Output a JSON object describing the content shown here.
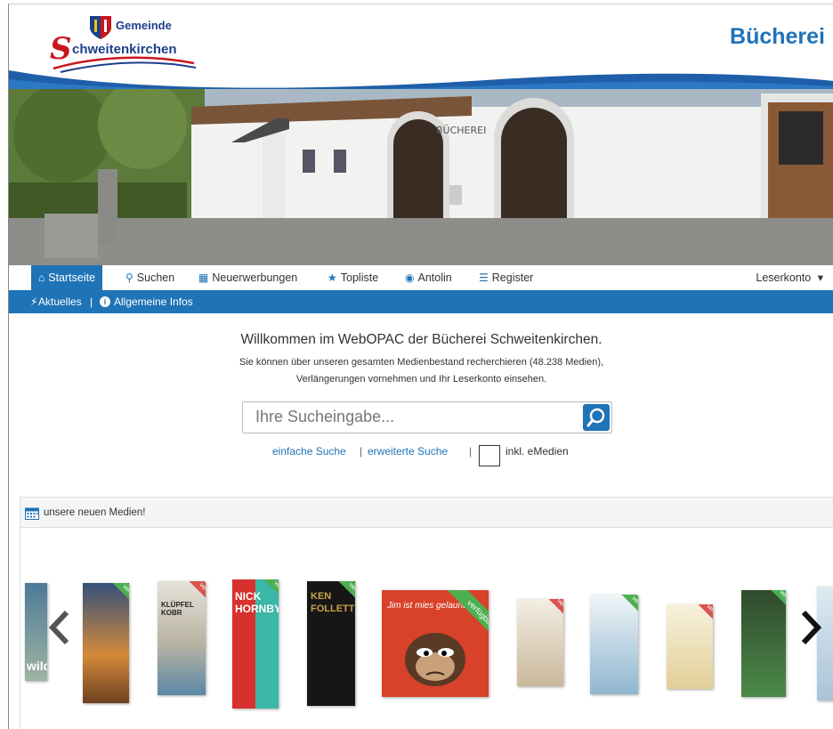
{
  "header": {
    "logo_line1": "Gemeinde",
    "logo_letter": "S",
    "logo_line2": "chweitenkirchen",
    "brand": "Bücherei",
    "hero_sign": "BÜCHEREI"
  },
  "nav": {
    "items": [
      {
        "label": "Startseite",
        "icon": "home-icon"
      },
      {
        "label": "Suchen",
        "icon": "search-icon"
      },
      {
        "label": "Neuerwerbungen",
        "icon": "calendar-icon"
      },
      {
        "label": "Topliste",
        "icon": "star-icon"
      },
      {
        "label": "Antolin",
        "icon": "globe-icon"
      },
      {
        "label": "Register",
        "icon": "list-icon"
      }
    ],
    "account_label": "Leserkonto",
    "account_caret": "▾"
  },
  "subnav": {
    "aktuelles": "Aktuelles",
    "separator": "|",
    "infos": "Allgemeine Infos"
  },
  "welcome": {
    "heading": "Willkommen im WebOPAC der Bücherei Schweitenkirchen.",
    "line1": "Sie können über unseren gesamten Medienbestand recherchieren (48.238 Medien),",
    "line2": "Verlängerungen vornehmen und Ihr Leserkonto einsehen."
  },
  "search": {
    "placeholder": "Ihre Sucheingabe...",
    "simple": "einfache Suche",
    "sep1": "|",
    "advanced": "erweiterte Suche",
    "sep2": "|",
    "emedien": "inkl. eMedien"
  },
  "panel": {
    "title": "unsere neuen Medien!"
  },
  "carousel": {
    "ribbon": "verfügbar",
    "books": [
      {
        "title": "wild"
      },
      {
        "title": ""
      },
      {
        "title": "KLÜPFEL KOBR"
      },
      {
        "title": "NICK HORNBY"
      },
      {
        "title": "KEN FOLLETT"
      },
      {
        "title": "Jim ist mies gelaunt"
      },
      {
        "title": ""
      },
      {
        "title": ""
      },
      {
        "title": ""
      },
      {
        "title": ""
      },
      {
        "title": ""
      }
    ],
    "prev_glyph": "‹",
    "next_glyph": "›"
  },
  "colors": {
    "accent": "#1f73b7",
    "ribbon": "#4caf50",
    "ribbon_red": "#d9534f"
  }
}
